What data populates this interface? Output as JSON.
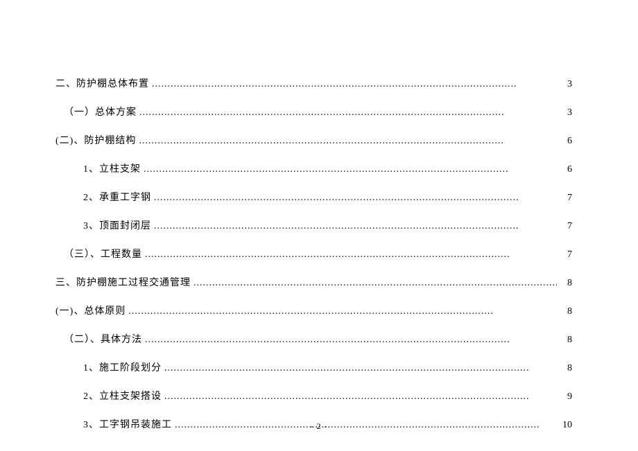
{
  "toc": [
    {
      "label": "二、防护棚总体布置",
      "page": "3",
      "indent": 1
    },
    {
      "label": "（一）总体方案",
      "page": "3",
      "indent": 2
    },
    {
      "label": "(二)、防护棚结构",
      "page": "6",
      "indent": 1
    },
    {
      "label": "1、立柱支架",
      "page": "6",
      "indent": 3
    },
    {
      "label": "2、承重工字钢",
      "page": "7",
      "indent": 3
    },
    {
      "label": "3、顶面封闭层",
      "page": "7",
      "indent": 3
    },
    {
      "label": "（三）、工程数量",
      "page": "7",
      "indent": 2
    },
    {
      "label": "三、防护棚施工过程交通管理",
      "page": "8",
      "indent": 1
    },
    {
      "label": "(一)、总体原则",
      "page": "8",
      "indent": 1
    },
    {
      "label": "（二）、具体方法",
      "page": "8",
      "indent": 2
    },
    {
      "label": "1、施工阶段划分",
      "page": "8",
      "indent": 3
    },
    {
      "label": "2、立柱支架搭设",
      "page": "9",
      "indent": 3
    },
    {
      "label": "3、工字钢吊装施工",
      "page": "10",
      "indent": 3
    }
  ],
  "page_number": "- 2 -"
}
